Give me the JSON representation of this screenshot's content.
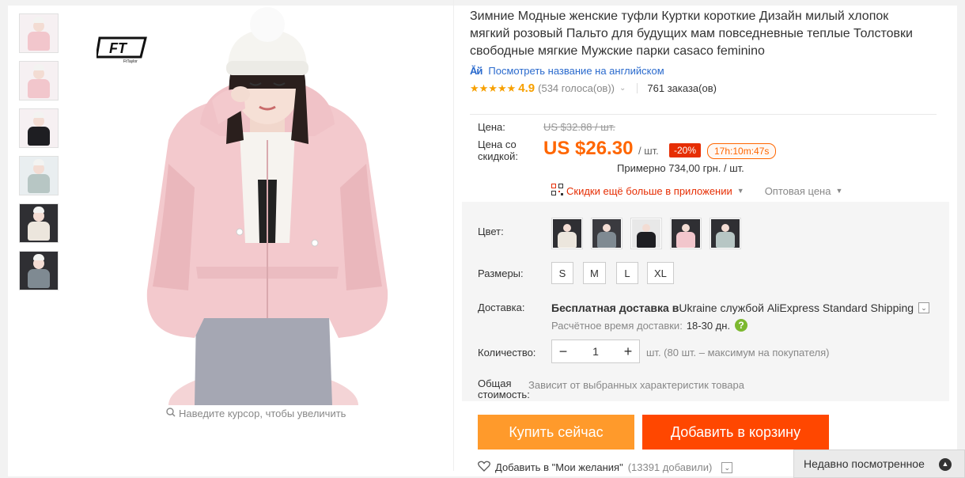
{
  "product": {
    "title": "Зимние Модные женские туфли Куртки короткие Дизайн милый хлопок мягкий розовый Пальто для будущих мам повседневные теплые Толстовки свободные мягкие Мужские парки casaco feminino",
    "translate_link": "Посмотреть название на английском",
    "translate_icon_text": "Ăй",
    "stars": "★★★★★",
    "rating": "4.9",
    "votes": "(534 голоса(ов))",
    "orders": "761 заказа(ов)"
  },
  "gallery": {
    "zoom_hint": "Наведите курсор, чтобы увеличить",
    "logo_text": "FT",
    "logo_sub": "FtTaylor",
    "thumbnails": [
      {
        "coat": "#f2c6cc",
        "bg": "#f6f0f2"
      },
      {
        "coat": "#f2c6cc",
        "bg": "#f6f0f2"
      },
      {
        "coat": "#1e1e22",
        "bg": "#f6f0f2"
      },
      {
        "coat": "#b7c6c4",
        "bg": "#e9eef0"
      },
      {
        "coat": "#ece6dd",
        "bg": "#2f2f33"
      },
      {
        "coat": "#7f8a92",
        "bg": "#2f2f33"
      }
    ]
  },
  "price": {
    "label": "Цена:",
    "old_price": "US $32.88 / шт.",
    "discount_label": "Цена со скидкой:",
    "new_price": "US $26.30",
    "per_unit": "/ шт.",
    "discount_badge": "-20%",
    "timer": "17h:10m:47s",
    "approx": "Примерно 734,00 грн. / шт.",
    "app_link": "Скидки ещё больше в приложении",
    "wholesale": "Оптовая цена"
  },
  "options": {
    "color_label": "Цвет:",
    "colors": [
      {
        "coat": "#ece6dd",
        "bg": "#2f2f33"
      },
      {
        "coat": "#7f8a92",
        "bg": "#3a3a3f"
      },
      {
        "coat": "#1e1e22",
        "bg": "#e8e8e8"
      },
      {
        "coat": "#f2c6cc",
        "bg": "#2f2f33"
      },
      {
        "coat": "#b7c6c4",
        "bg": "#2f2f33"
      }
    ],
    "size_label": "Размеры:",
    "sizes": [
      "S",
      "M",
      "L",
      "XL"
    ],
    "shipping_label": "Доставка:",
    "shipping_prefix": "Бесплатная доставка в",
    "shipping_rest": " Ukraine службой AliExpress Standard Shipping",
    "shipping_time_label": "Расчётное время доставки:",
    "shipping_time": "18-30 дн.",
    "quantity_label": "Количество:",
    "quantity": "1",
    "quantity_note": "шт. (80 шт. – максимум на покупателя)",
    "total_label": "Общая стоимость:",
    "total_note": "Зависит от выбранных характеристик товара"
  },
  "actions": {
    "buy_now": "Купить сейчас",
    "add_to_cart": "Добавить в корзину",
    "wishlist": "Добавить в \"Мои желания\"",
    "wishlist_count": "(13391 добавили)"
  },
  "recent": {
    "label": "Недавно посмотренное"
  },
  "colors": {
    "accent_orange": "#ff6600",
    "buy_button": "#ff9a2b",
    "cart_button": "#ff4700",
    "link_blue": "#2a6acd",
    "badge_red": "#e62e04"
  }
}
